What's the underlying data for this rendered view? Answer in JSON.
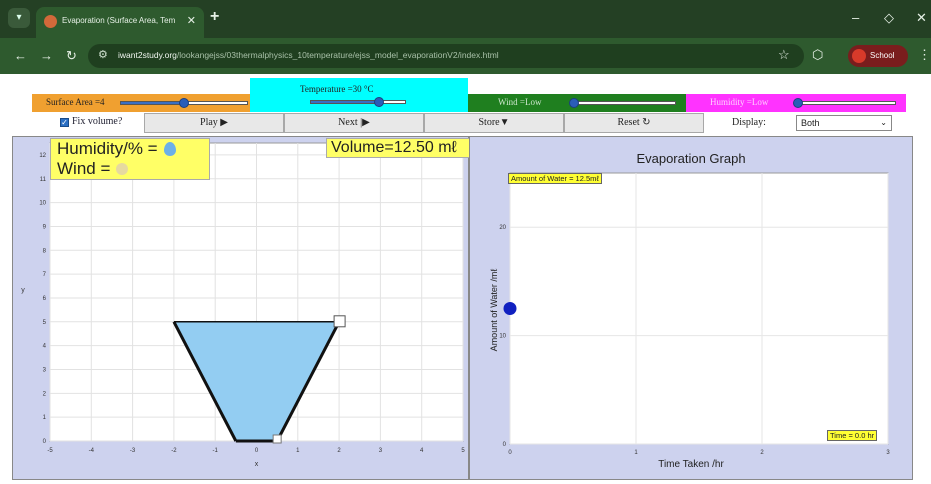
{
  "browser": {
    "tab_title": "Evaporation (Surface Area, Tem",
    "url_host": "iwant2study.org",
    "url_path": "/lookangejss/03thermalphysics_10temperature/ejss_model_evaporationV2/index.html",
    "profile_label": "School",
    "icons": [
      "tab-menu-icon",
      "favicon-icon",
      "close-icon",
      "plus-icon",
      "minimize-icon",
      "restore-icon",
      "close-window-icon",
      "back-icon",
      "forward-icon",
      "reload-icon",
      "site-info-icon",
      "star-icon",
      "extensions-icon",
      "avatar-icon",
      "kebab-menu-icon"
    ]
  },
  "controls": {
    "surface_area_label": "Surface Area =4",
    "surface_area_level": 0.5,
    "temperature_label": "Temperature =30 °C",
    "temperature_level": 0.72,
    "wind_label": "Wind =Low",
    "wind_level": 0.0,
    "humidity_label": "Humidity =Low",
    "humidity_level": 0.0,
    "fix_volume_label": "Fix volume?",
    "fix_volume_checked": true,
    "play_label": "Play ▶",
    "next_label": "Next |▶",
    "store_label": "Store▼",
    "reset_label": "Reset ↻",
    "display_label": "Display:",
    "display_value": "Both",
    "colors": {
      "surface_area": "#f0a030",
      "temperature": "#00ffff",
      "wind": "#1f7f1f",
      "humidity": "#ff33ff"
    }
  },
  "left_panel": {
    "humidity_text": "Humidity/% =",
    "wind_text": "Wind =",
    "volume_text": "Volume=12.50 mℓ",
    "xlabel": "x",
    "ylabel": "y",
    "x_ticks": [
      "-5",
      "-4",
      "-3",
      "-2",
      "-1",
      "0",
      "1",
      "2",
      "3",
      "4",
      "5"
    ],
    "y_ticks": [
      "0",
      "1",
      "2",
      "3",
      "4",
      "5",
      "6",
      "7",
      "8",
      "9",
      "10",
      "11",
      "12"
    ],
    "container": {
      "top_left": [
        -2,
        5
      ],
      "top_right": [
        2,
        5
      ],
      "bottom_left": [
        -0.5,
        0
      ],
      "bottom_right": [
        0.5,
        0
      ],
      "water_level": 5
    }
  },
  "chart_data": {
    "type": "scatter",
    "title": "Evaporation Graph",
    "xlabel": "Time Taken /hr",
    "ylabel": "Amount of Water /mℓ",
    "x_ticks": [
      "0",
      "1",
      "2",
      "3"
    ],
    "y_ticks": [
      "0",
      "10",
      "20"
    ],
    "xlim": [
      0,
      3
    ],
    "ylim": [
      0,
      25
    ],
    "points": [
      {
        "x": 0,
        "y": 12.5
      }
    ],
    "annotations": {
      "amount": "Amount of Water = 12.5mℓ",
      "time": "Time = 0.0 hr"
    },
    "point_color": "#1020c0"
  }
}
